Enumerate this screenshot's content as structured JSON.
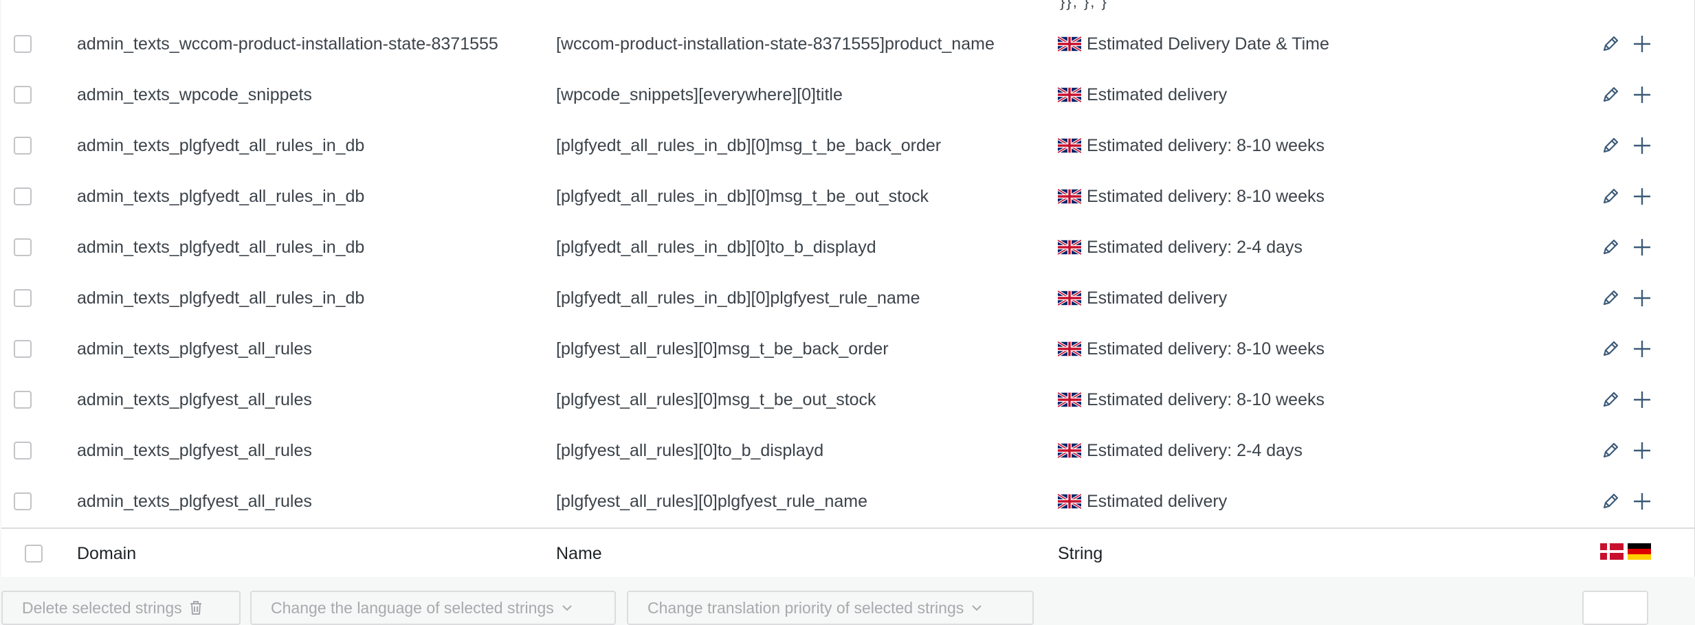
{
  "top_fragment": "}},   }, }",
  "rows": [
    {
      "domain": "admin_texts_wccom-product-installation-state-8371555",
      "name": "[wccom-product-installation-state-8371555]product_name",
      "string": "Estimated Delivery Date & Time"
    },
    {
      "domain": "admin_texts_wpcode_snippets",
      "name": "[wpcode_snippets][everywhere][0]title",
      "string": "Estimated delivery"
    },
    {
      "domain": "admin_texts_plgfyedt_all_rules_in_db",
      "name": "[plgfyedt_all_rules_in_db][0]msg_t_be_back_order",
      "string": "Estimated delivery: 8-10 weeks"
    },
    {
      "domain": "admin_texts_plgfyedt_all_rules_in_db",
      "name": "[plgfyedt_all_rules_in_db][0]msg_t_be_out_stock",
      "string": "Estimated delivery: 8-10 weeks"
    },
    {
      "domain": "admin_texts_plgfyedt_all_rules_in_db",
      "name": "[plgfyedt_all_rules_in_db][0]to_b_displayd",
      "string": "Estimated delivery: 2-4 days"
    },
    {
      "domain": "admin_texts_plgfyedt_all_rules_in_db",
      "name": "[plgfyedt_all_rules_in_db][0]plgfyest_rule_name",
      "string": "Estimated delivery"
    },
    {
      "domain": "admin_texts_plgfyest_all_rules",
      "name": "[plgfyest_all_rules][0]msg_t_be_back_order",
      "string": "Estimated delivery: 8-10 weeks"
    },
    {
      "domain": "admin_texts_plgfyest_all_rules",
      "name": "[plgfyest_all_rules][0]msg_t_be_out_stock",
      "string": "Estimated delivery: 8-10 weeks"
    },
    {
      "domain": "admin_texts_plgfyest_all_rules",
      "name": "[plgfyest_all_rules][0]to_b_displayd",
      "string": "Estimated delivery: 2-4 days"
    },
    {
      "domain": "admin_texts_plgfyest_all_rules",
      "name": "[plgfyest_all_rules][0]plgfyest_rule_name",
      "string": "Estimated delivery"
    }
  ],
  "footer": {
    "domain": "Domain",
    "name": "Name",
    "string": "String"
  },
  "bulk_actions": {
    "delete": "Delete selected strings",
    "change_language": "Change the language of selected strings",
    "change_priority": "Change translation priority of selected strings"
  },
  "icons": {
    "row_language_flag": "uk-flag-icon",
    "edit": "pencil-icon",
    "add": "plus-icon",
    "footer_flags": [
      "denmark-flag-icon",
      "germany-flag-icon"
    ]
  },
  "colors": {
    "action_icon": "#3c5a78",
    "uk_blue": "#012169",
    "uk_red": "#c8102e",
    "dk_red": "#c8102e"
  }
}
